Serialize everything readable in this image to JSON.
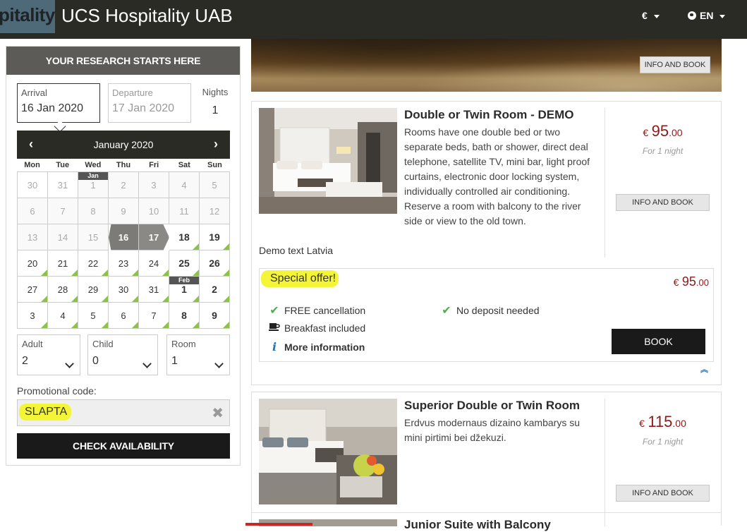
{
  "header": {
    "logo_text": "pitality",
    "title": "UCS Hospitality UAB",
    "currency": "€",
    "language": "EN"
  },
  "search": {
    "heading": "YOUR RESEARCH STARTS HERE",
    "arrival_label": "Arrival",
    "arrival_value": "16 Jan 2020",
    "departure_label": "Departure",
    "departure_value": "17 Jan 2020",
    "nights_label": "Nights",
    "nights_value": "1",
    "calendar": {
      "month": "January 2020",
      "prev": "‹",
      "next": "›",
      "weekdays": [
        "Mon",
        "Tue",
        "Wed",
        "Thu",
        "Fri",
        "Sat",
        "Sun"
      ],
      "month_tags": {
        "jan": "Jan",
        "feb": "Feb"
      },
      "days": [
        [
          "30",
          "31",
          "1",
          "2",
          "3",
          "4",
          "5"
        ],
        [
          "6",
          "7",
          "8",
          "9",
          "10",
          "11",
          "12"
        ],
        [
          "13",
          "14",
          "15",
          "16",
          "17",
          "18",
          "19"
        ],
        [
          "20",
          "21",
          "22",
          "23",
          "24",
          "25",
          "26"
        ],
        [
          "27",
          "28",
          "29",
          "30",
          "31",
          "1",
          "2"
        ],
        [
          "3",
          "4",
          "5",
          "6",
          "7",
          "8",
          "9"
        ]
      ]
    },
    "adult_label": "Adult",
    "adult_value": "2",
    "child_label": "Child",
    "child_value": "0",
    "room_label": "Room",
    "room_value": "1",
    "promo_label": "Promotional code:",
    "promo_value": "SLAPTA",
    "check_button": "CHECK AVAILABILITY"
  },
  "hero": {
    "button": "INFO AND BOOK"
  },
  "rooms": [
    {
      "title": "Double or Twin Room - DEMO",
      "description": "Rooms have one double bed or two separate beds, bath or shower, direct deal telephone, satellite TV, mini bar, light proof curtains, electronic door locking system, individually controlled air conditioning. Reserve a room with balcony to the river side or view to the old town.",
      "note": "Demo text Latvia",
      "currency": "€",
      "price_int": "95",
      "price_dec": ".00",
      "per_night": "For 1 night",
      "button": "INFO AND BOOK",
      "offer": {
        "title": "Special offer!",
        "currency": "€",
        "price_int": "95",
        "price_dec": ".00",
        "free_cancellation": "FREE cancellation",
        "no_deposit": "No deposit needed",
        "breakfast": "Breakfast included",
        "more_info": "More information",
        "book": "BOOK"
      }
    },
    {
      "title": "Superior Double or Twin Room",
      "description": "Erdvus modernaus dizaino kambarys su mini pirtimi bei džekuzi.",
      "currency": "€",
      "price_int": "115",
      "price_dec": ".00",
      "per_night": "For 1 night",
      "button": "INFO AND BOOK"
    },
    {
      "title": "Junior Suite with Balcony"
    }
  ],
  "colors": {
    "header_bg": "#2b2b26",
    "price": "#8b1a1a",
    "available": "#8bc34a",
    "highlight": "#f5f538",
    "info": "#1a75bb"
  }
}
